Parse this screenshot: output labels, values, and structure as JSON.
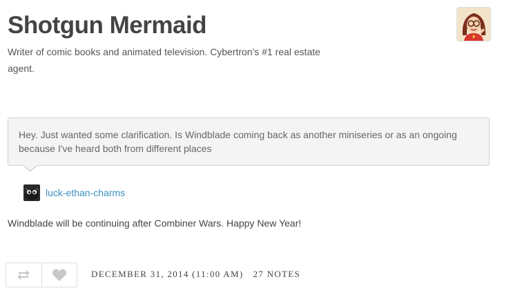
{
  "blog": {
    "title": "Shotgun Mermaid",
    "description": "Writer of comic books and animated television. Cybertron's #1 real estate agent."
  },
  "post": {
    "question": "Hey. Just wanted some clarification. Is Windblade coming back as another miniseries or as an ongoing because I've heard both from different places",
    "asker": "luck-ethan-charms",
    "answer": "Windblade will be continuing after Combiner Wars. Happy New Year!",
    "date": "DECEMBER 31, 2014 (11:00 AM)",
    "notes": "27 NOTES"
  },
  "icons": {
    "reblog": "reblog-icon",
    "like": "heart-icon"
  },
  "colors": {
    "text": "#444444",
    "link": "#3a8fbf",
    "question_bg": "#f4f4f4",
    "border": "#d2d2d2",
    "icon": "#c8c8c8"
  }
}
